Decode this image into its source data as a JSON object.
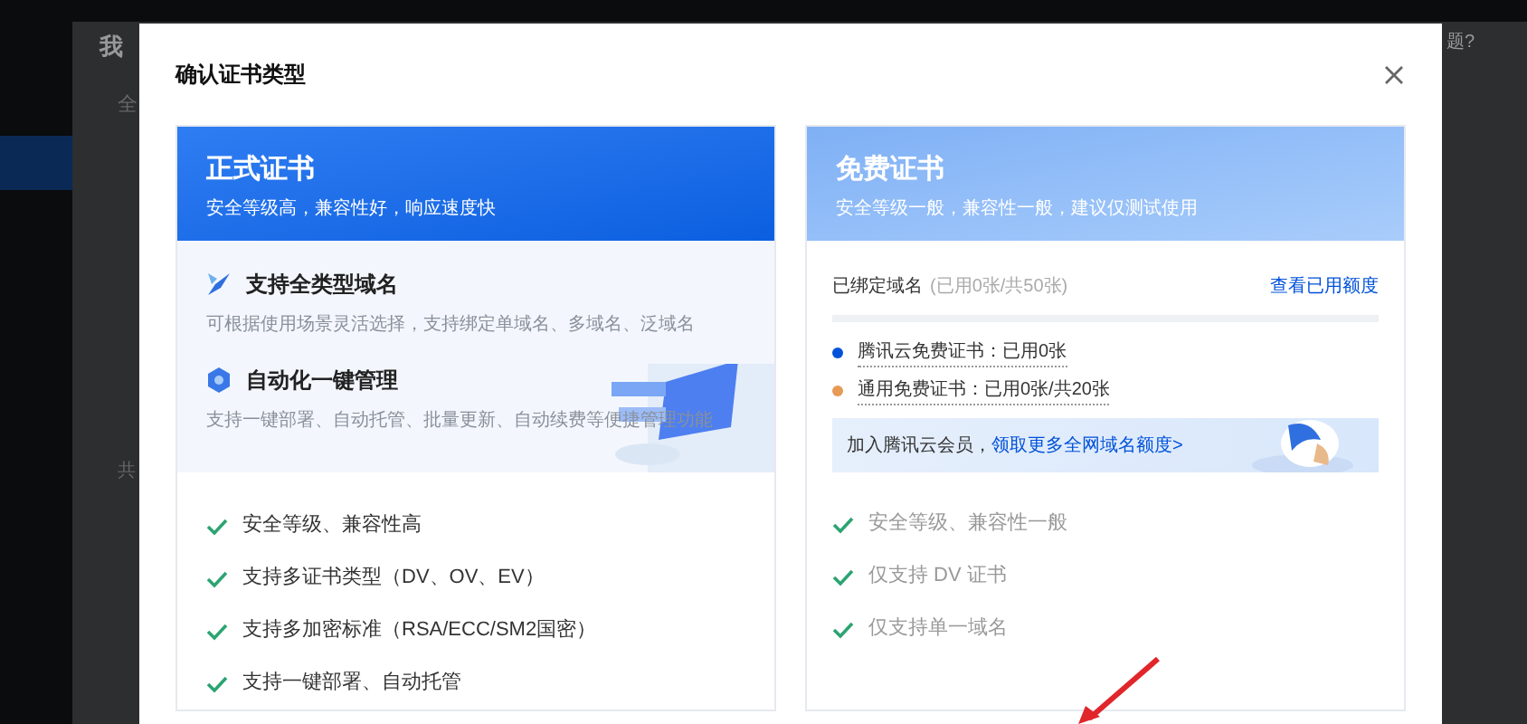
{
  "background_page": {
    "title": "我",
    "tab": "全",
    "help_text": "题?",
    "footer_text": "共"
  },
  "dialog": {
    "title": "确认证书类型",
    "cards": [
      {
        "kind": "paid",
        "title": "正式证书",
        "subtitle": "安全等级高，兼容性好，响应速度快",
        "features": [
          {
            "title": "支持全类型域名",
            "desc": "可根据使用场景灵活选择，支持绑定单域名、多域名、泛域名"
          },
          {
            "title": "自动化一键管理",
            "desc": "支持一键部署、自动托管、批量更新、自动续费等便捷管理功能"
          }
        ],
        "checks": [
          "安全等级、兼容性高",
          "支持多证书类型（DV、OV、EV）",
          "支持多加密标准（RSA/ECC/SM2国密）",
          "支持一键部署、自动托管"
        ]
      },
      {
        "kind": "free",
        "title": "免费证书",
        "subtitle": "安全等级一般，兼容性一般，建议仅测试使用",
        "quota": {
          "label": "已绑定域名",
          "detail": "(已用0张/共50张)",
          "link": "查看已用额度",
          "items": [
            {
              "text": "腾讯云免费证书：已用0张",
              "color": "#0052d9"
            },
            {
              "text": "通用免费证书：已用0张/共20张",
              "color": "#e59a55"
            }
          ],
          "banner": {
            "text": "加入腾讯云会员，",
            "link": "领取更多全网域名额度>"
          }
        },
        "checks": [
          "安全等级、兼容性一般",
          "仅支持 DV 证书",
          "仅支持单一域名"
        ]
      }
    ]
  }
}
